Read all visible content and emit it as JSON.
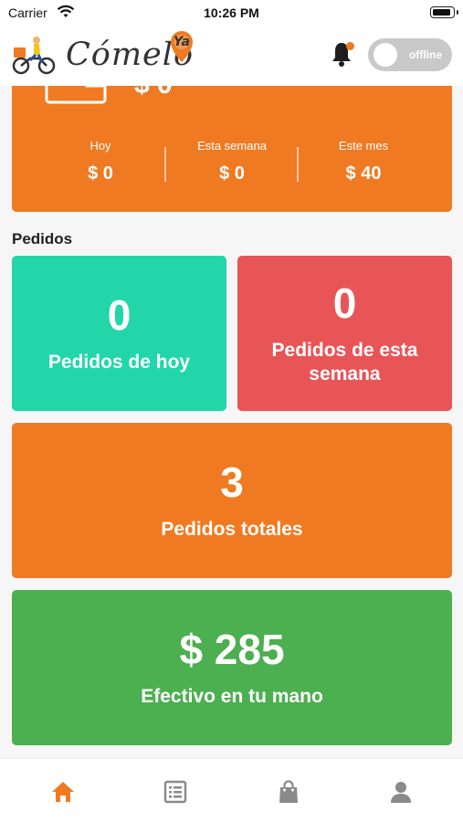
{
  "status_bar": {
    "carrier": "Carrier",
    "time": "10:26 PM"
  },
  "header": {
    "brand": "Cómelo",
    "brand_suffix": "Ya",
    "availability_label": "offline",
    "accent_color": "#f07a1f"
  },
  "earnings": {
    "top_value": "$ 0",
    "periods": [
      {
        "label": "Hoy",
        "value": "$ 0"
      },
      {
        "label": "Esta semana",
        "value": "$ 0"
      },
      {
        "label": "Este mes",
        "value": "$ 40"
      }
    ],
    "color": "#ef7a22"
  },
  "orders": {
    "section_title": "Pedidos",
    "today": {
      "count": "0",
      "label": "Pedidos de hoy",
      "color": "#22d6a9"
    },
    "week": {
      "count": "0",
      "label": "Pedidos de esta semana",
      "color": "#e85557"
    },
    "total": {
      "count": "3",
      "label": "Pedidos totales",
      "color": "#ef7a22"
    },
    "cash": {
      "amount": "$ 285",
      "label": "Efectivo en tu mano",
      "color": "#4caf50"
    }
  },
  "tabbar": {
    "tabs": [
      {
        "icon": "home-icon",
        "active": true
      },
      {
        "icon": "list-icon",
        "active": false
      },
      {
        "icon": "shopping-bag-icon",
        "active": false
      },
      {
        "icon": "profile-icon",
        "active": false
      }
    ],
    "active_color": "#f07a1f",
    "inactive_color": "#8a8a8a"
  }
}
